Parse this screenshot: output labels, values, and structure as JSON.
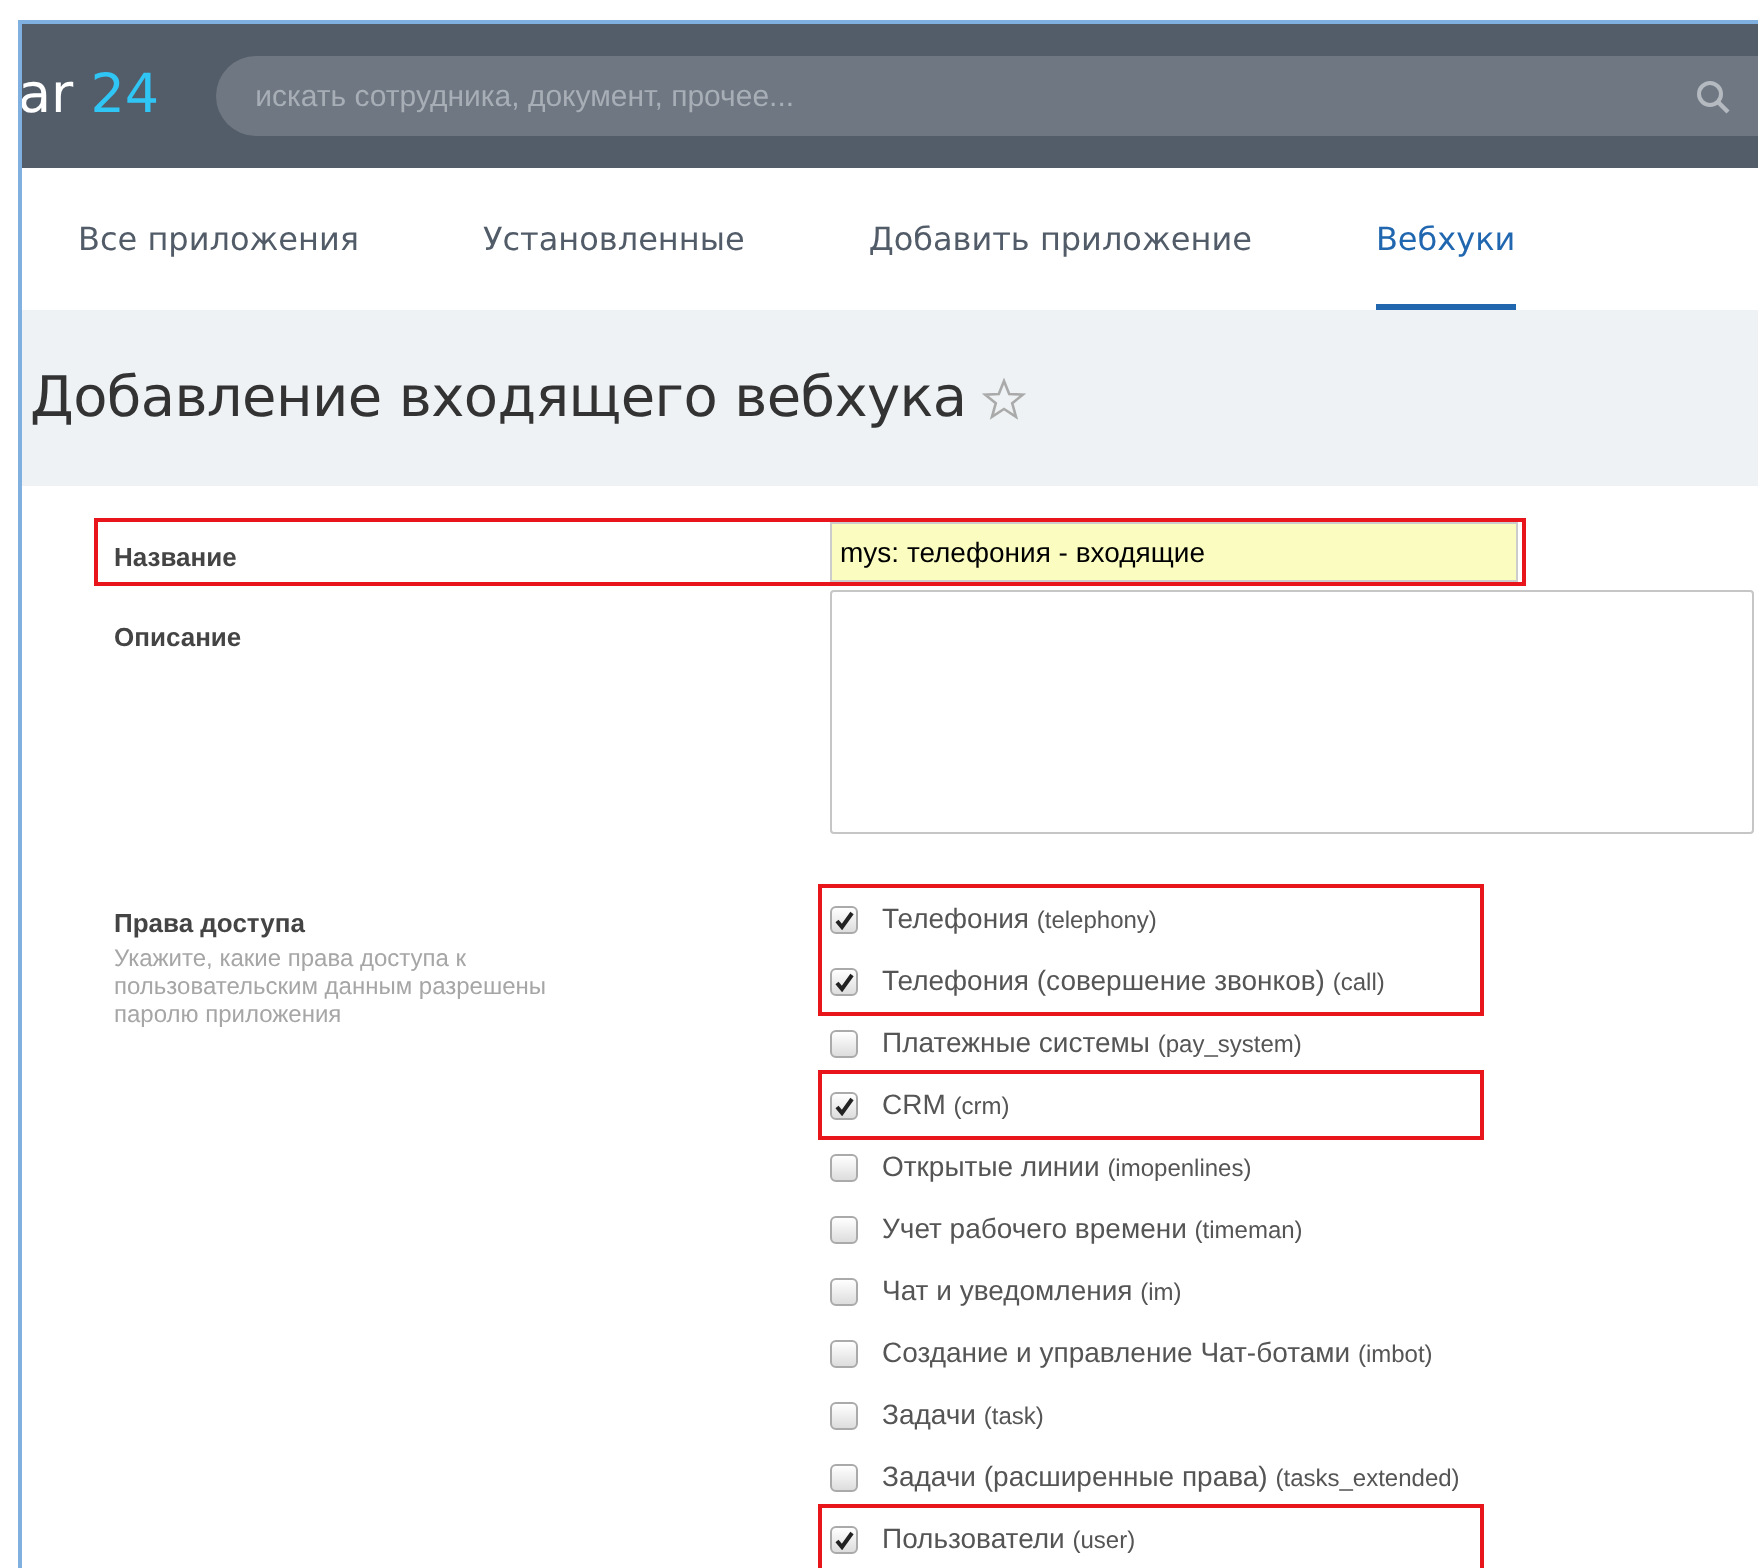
{
  "header": {
    "logo_cut": "ar",
    "logo_number": "24",
    "search": {
      "placeholder": "искать сотрудника, документ, прочее..."
    }
  },
  "tabs": [
    {
      "label": "Все приложения",
      "selected": false
    },
    {
      "label": "Установленные",
      "selected": false
    },
    {
      "label": "Добавить приложение",
      "selected": false
    },
    {
      "label": "Вебхуки",
      "selected": true
    }
  ],
  "page_title": "Добавление входящего вебхука",
  "favorite": false,
  "form": {
    "name": {
      "label": "Название",
      "value": "mys: телефония - входящие",
      "highlighted": true
    },
    "description": {
      "label": "Описание"
    },
    "permissions": {
      "label": "Права доступа",
      "hint": "Укажите, какие права доступа к пользовательским данным разрешены паролю приложения",
      "items": [
        {
          "label": "Телефония",
          "code": "(telephony)",
          "checked": true,
          "highlighted": true
        },
        {
          "label": "Телефония (совершение звонков)",
          "code": "(call)",
          "checked": true,
          "highlighted": true
        },
        {
          "label": "Платежные системы",
          "code": "(pay_system)",
          "checked": false,
          "highlighted": false
        },
        {
          "label": "CRM",
          "code": "(crm)",
          "checked": true,
          "highlighted": true
        },
        {
          "label": "Открытые линии",
          "code": "(imopenlines)",
          "checked": false,
          "highlighted": false
        },
        {
          "label": "Учет рабочего времени",
          "code": "(timeman)",
          "checked": false,
          "highlighted": false
        },
        {
          "label": "Чат и уведомления",
          "code": "(im)",
          "checked": false,
          "highlighted": false
        },
        {
          "label": "Создание и управление Чат-ботами",
          "code": "(imbot)",
          "checked": false,
          "highlighted": false
        },
        {
          "label": "Задачи",
          "code": "(task)",
          "checked": false,
          "highlighted": false
        },
        {
          "label": "Задачи (расширенные права)",
          "code": "(tasks_extended)",
          "checked": false,
          "highlighted": false
        },
        {
          "label": "Пользователи",
          "code": "(user)",
          "checked": true,
          "highlighted": true
        }
      ]
    }
  }
}
